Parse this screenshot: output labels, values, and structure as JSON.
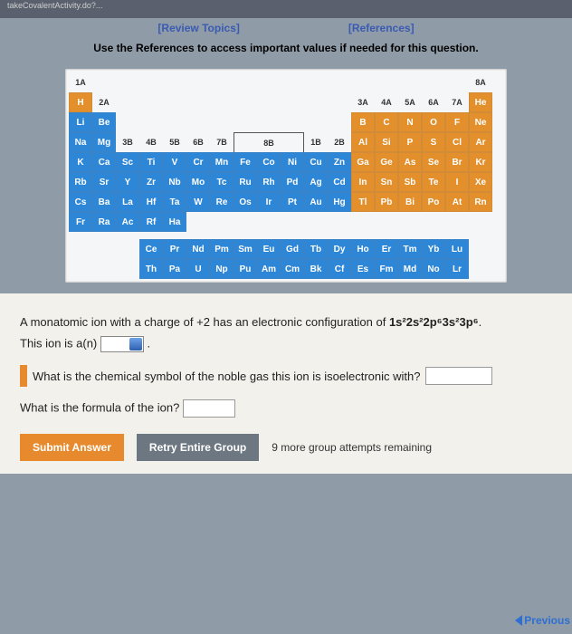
{
  "top_strip": "takeCovalentActivity.do?...",
  "links": {
    "review": "[Review Topics]",
    "references": "[References]"
  },
  "instructions": "Use the References to access important values if needed for this question.",
  "groups": {
    "g1": "1A",
    "g2": "2A",
    "g3": "3B",
    "g4": "4B",
    "g5": "5B",
    "g6": "6B",
    "g7": "7B",
    "g8": "8B",
    "g11": "1B",
    "g12": "2B",
    "g13": "3A",
    "g14": "4A",
    "g15": "5A",
    "g16": "6A",
    "g17": "7A",
    "g18": "8A"
  },
  "el": {
    "H": "H",
    "He": "He",
    "Li": "Li",
    "Be": "Be",
    "B": "B",
    "C": "C",
    "N": "N",
    "O": "O",
    "F": "F",
    "Ne": "Ne",
    "Na": "Na",
    "Mg": "Mg",
    "Al": "Al",
    "Si": "Si",
    "P": "P",
    "S": "S",
    "Cl": "Cl",
    "Ar": "Ar",
    "K": "K",
    "Ca": "Ca",
    "Sc": "Sc",
    "Ti": "Ti",
    "V": "V",
    "Cr": "Cr",
    "Mn": "Mn",
    "Fe": "Fe",
    "Co": "Co",
    "Ni": "Ni",
    "Cu": "Cu",
    "Zn": "Zn",
    "Ga": "Ga",
    "Ge": "Ge",
    "As": "As",
    "Se": "Se",
    "Br": "Br",
    "Kr": "Kr",
    "Rb": "Rb",
    "Sr": "Sr",
    "Y": "Y",
    "Zr": "Zr",
    "Nb": "Nb",
    "Mo": "Mo",
    "Tc": "Tc",
    "Ru": "Ru",
    "Rh": "Rh",
    "Pd": "Pd",
    "Ag": "Ag",
    "Cd": "Cd",
    "In": "In",
    "Sn": "Sn",
    "Sb": "Sb",
    "Te": "Te",
    "I": "I",
    "Xe": "Xe",
    "Cs": "Cs",
    "Ba": "Ba",
    "La": "La",
    "Hf": "Hf",
    "Ta": "Ta",
    "W": "W",
    "Re": "Re",
    "Os": "Os",
    "Ir": "Ir",
    "Pt": "Pt",
    "Au": "Au",
    "Hg": "Hg",
    "Tl": "Tl",
    "Pb": "Pb",
    "Bi": "Bi",
    "Po": "Po",
    "At": "At",
    "Rn": "Rn",
    "Fr": "Fr",
    "Ra": "Ra",
    "Ac": "Ac",
    "Rf": "Rf",
    "Ha": "Ha",
    "Ce": "Ce",
    "Pr": "Pr",
    "Nd": "Nd",
    "Pm": "Pm",
    "Sm": "Sm",
    "Eu": "Eu",
    "Gd": "Gd",
    "Tb": "Tb",
    "Dy": "Dy",
    "Ho": "Ho",
    "Er": "Er",
    "Tm": "Tm",
    "Yb": "Yb",
    "Lu": "Lu",
    "Th": "Th",
    "Pa": "Pa",
    "U": "U",
    "Np": "Np",
    "Pu": "Pu",
    "Am": "Am",
    "Cm": "Cm",
    "Bk": "Bk",
    "Cf": "Cf",
    "Es": "Es",
    "Fm": "Fm",
    "Md": "Md",
    "No": "No",
    "Lr": "Lr"
  },
  "question": {
    "line1_pre": "A monatomic ion with a charge of +2 has an electronic configuration of ",
    "config": "1s²2s²2p⁶3s²3p⁶",
    "line1_post": ".",
    "line2_pre": "This ion is a(n) ",
    "line2_post": ".",
    "line3": "What is the chemical symbol of the noble gas this ion is isoelectronic with?",
    "line4": "What is the formula of the ion?"
  },
  "buttons": {
    "submit": "Submit Answer",
    "retry": "Retry Entire Group"
  },
  "attempts": "9 more group attempts remaining",
  "prev": "Previous"
}
